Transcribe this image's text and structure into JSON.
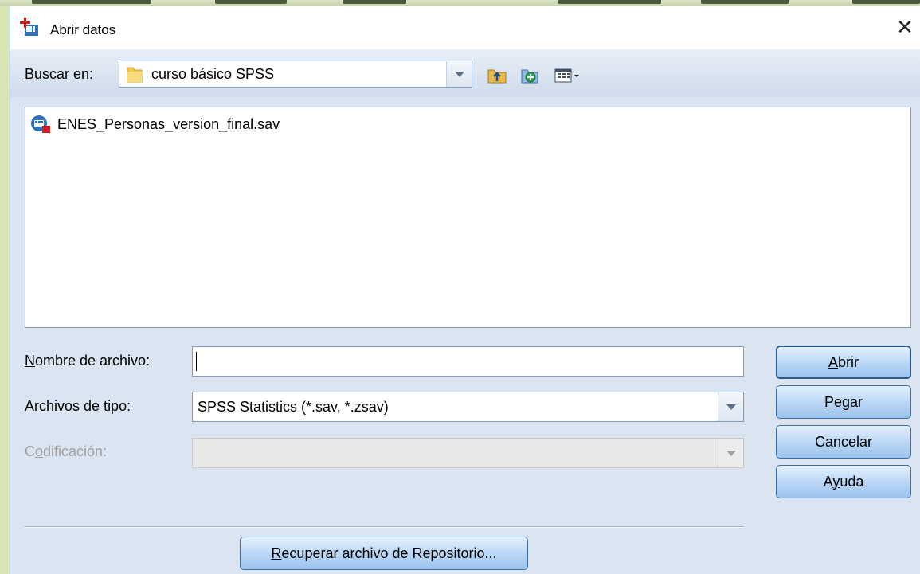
{
  "window": {
    "title": "Abrir datos",
    "close_symbol": "✕"
  },
  "toolbar": {
    "lookin_label": "Buscar en:",
    "lookin_underline": "B",
    "lookin_rest": "uscar en:",
    "lookin_value": "curso básico SPSS",
    "icons": [
      "up-folder-icon",
      "new-folder-icon",
      "view-menu-icon"
    ]
  },
  "files": [
    {
      "name": "ENES_Personas_version_final.sav",
      "icon": "spss-data-file-icon"
    }
  ],
  "form": {
    "filename_label": "Nombre de archivo:",
    "filename_underline": "N",
    "filename_rest": "ombre de archivo:",
    "filename_value": "",
    "filetype_label": "Archivos de tipo:",
    "filetype_pre": "Archivos de ",
    "filetype_underline": "t",
    "filetype_rest": "ipo:",
    "filetype_value": "SPSS Statistics (*.sav, *.zsav)",
    "encoding_label": "Codificación:",
    "encoding_pre": "C",
    "encoding_underline": "o",
    "encoding_rest": "dificación:",
    "encoding_value": ""
  },
  "buttons": {
    "open": {
      "label": "Abrir",
      "underline": "A",
      "rest": "brir"
    },
    "paste": {
      "label": "Pegar",
      "underline": "P",
      "rest": "egar"
    },
    "cancel": {
      "label": "Cancelar"
    },
    "help": {
      "label": "Ayuda",
      "pre": "A",
      "underline": "y",
      "rest": "uda"
    },
    "repository": {
      "label": "Recuperar archivo de Repositorio...",
      "underline": "R",
      "rest": "ecuperar archivo de Repositorio..."
    }
  },
  "colors": {
    "dialog_bg": "#dbe5f1",
    "button_border": "#3a6ea5",
    "desktop_bg": "#c8d8a8"
  }
}
